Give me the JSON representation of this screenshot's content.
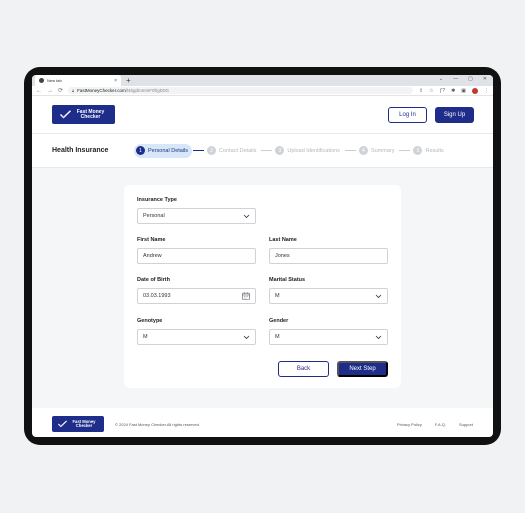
{
  "browser": {
    "tab_title": "New tab",
    "tab_close": "×",
    "new_tab": "+",
    "window_controls": [
      "⌄",
      "—",
      "▢",
      "✕"
    ],
    "nav": [
      "←",
      "→",
      "⟳"
    ],
    "url_host": "FastMoneyChecker.com",
    "url_path": "/l46gdmmmF0frgD0G",
    "ext_icons": [
      "⇪",
      "☆",
      "ƒ?",
      "✱",
      "▣"
    ]
  },
  "header": {
    "logo_text": "Fast Money Checker",
    "login_label": "Log In",
    "signup_label": "Sign Up"
  },
  "stepper": {
    "page_title": "Health Insurance",
    "steps": [
      {
        "num": "1",
        "label": "Personal Details"
      },
      {
        "num": "2",
        "label": "Contact Details"
      },
      {
        "num": "3",
        "label": "Upload Identifications"
      },
      {
        "num": "4",
        "label": "Summary"
      },
      {
        "num": "5",
        "label": "Results"
      }
    ],
    "active_step": 1
  },
  "form": {
    "insurance_type": {
      "label": "Insurance Type",
      "value": "Personal"
    },
    "first_name": {
      "label": "First Name",
      "value": "Andrew"
    },
    "last_name": {
      "label": "Last Name",
      "value": "Jones"
    },
    "dob": {
      "label": "Date of Birth",
      "value": "03.03.1993"
    },
    "marital_status": {
      "label": "Marital Status",
      "value": "M"
    },
    "genotype": {
      "label": "Genotype",
      "value": "M"
    },
    "gender": {
      "label": "Gender",
      "value": "M"
    },
    "back_label": "Back",
    "next_label": "Next Step"
  },
  "footer": {
    "logo_text": "Fast Money Checker",
    "copyright": "© 2024 Fast Money Checker.All rights reserved.",
    "links": [
      "Privacy Policy",
      "F.A.Q.",
      "Support"
    ]
  },
  "colors": {
    "brand": "#1f2d8a",
    "active_step_bg": "#d6e7f8",
    "form_bg": "#f5f6f8"
  }
}
